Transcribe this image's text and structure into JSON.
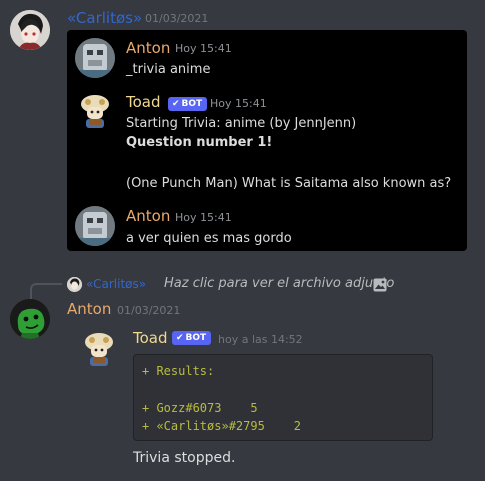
{
  "message1": {
    "username": "«Carlitøs»",
    "timestamp": "01/03/2021",
    "username_color": "#3366cc",
    "screenshot": {
      "messages": [
        {
          "username": "Anton",
          "timestamp": "Hoy 15:41",
          "lines": [
            "_trivia anime"
          ]
        },
        {
          "username": "Toad",
          "bot_label": "BOT",
          "timestamp": "Hoy 15:41",
          "lines": [
            "Starting Trivia: anime (by JennJenn)",
            "Question number 1!",
            "",
            "(One Punch Man) What is Saitama also known as?"
          ]
        },
        {
          "username": "Anton",
          "timestamp": "Hoy 15:41",
          "lines": [
            "a ver quien es mas gordo"
          ]
        }
      ]
    }
  },
  "message2": {
    "reply": {
      "username": "«Carlitøs»",
      "text": "Haz clic para ver el archivo adjunto"
    },
    "username": "Anton",
    "timestamp": "01/03/2021",
    "username_color": "#e8a96b"
  },
  "message3": {
    "username": "Toad",
    "bot_label": "BOT",
    "timestamp": "hoy a las 14:52",
    "username_color": "#f0d890",
    "code_lines": [
      "+ Results:",
      "",
      "+ Gozz#6073    5",
      "+ «Carlitøs»#2795    2"
    ],
    "text": "Trivia stopped."
  },
  "colors": {
    "background": "#36393f",
    "bot_tag": "#5865f2",
    "anton_in_screenshot": "#e8a96b",
    "toad_in_screenshot": "#f0d890"
  }
}
